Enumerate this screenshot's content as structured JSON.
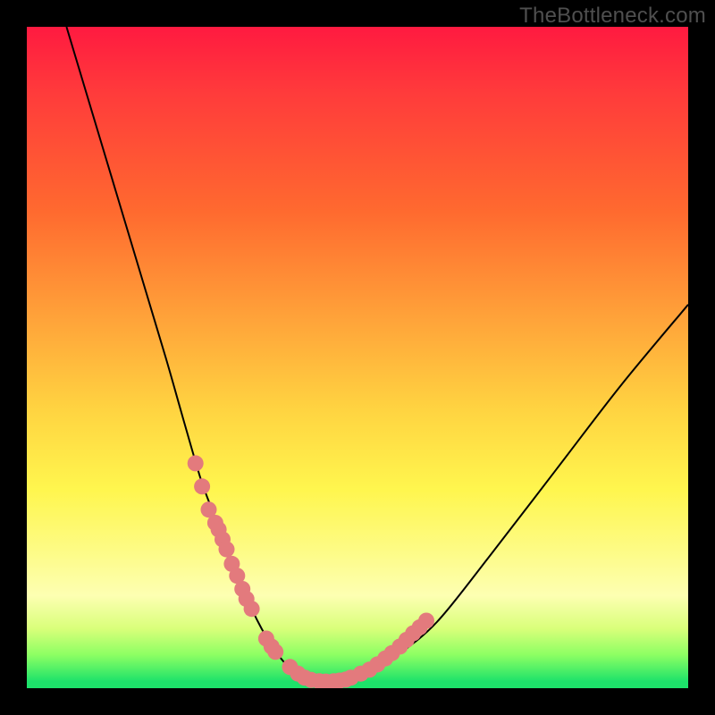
{
  "watermark": "TheBottleneck.com",
  "colors": {
    "background": "#000000",
    "gradient_top": "#ff1a40",
    "gradient_bottom": "#1de26a",
    "curve": "#000000",
    "dots": "#e37a7d"
  },
  "chart_data": {
    "type": "line",
    "title": "",
    "xlabel": "",
    "ylabel": "",
    "xlim": [
      0,
      100
    ],
    "ylim": [
      0,
      100
    ],
    "grid": false,
    "legend": false,
    "series": [
      {
        "name": "bottleneck-curve",
        "x": [
          6,
          9,
          12,
          15,
          18,
          21,
          23,
          25,
          26.5,
          28,
          29.5,
          31,
          32.5,
          34,
          35.5,
          37,
          38.5,
          40,
          41.5,
          43,
          45,
          48,
          52,
          56,
          62,
          70,
          80,
          90,
          100
        ],
        "y": [
          100,
          90,
          80,
          70,
          60,
          50,
          43,
          36,
          31,
          27,
          23,
          19,
          15.5,
          12,
          9,
          6.5,
          4.4,
          2.8,
          1.7,
          1.2,
          1.0,
          1.2,
          2.5,
          5,
          10,
          20,
          33,
          46,
          58
        ]
      }
    ],
    "scatter_overlay": {
      "name": "highlight-dots",
      "color": "#e37a7d",
      "points": [
        {
          "x": 25.5,
          "y": 34
        },
        {
          "x": 26.5,
          "y": 30.5
        },
        {
          "x": 27.5,
          "y": 27
        },
        {
          "x": 28.5,
          "y": 25
        },
        {
          "x": 29.0,
          "y": 24
        },
        {
          "x": 29.6,
          "y": 22.5
        },
        {
          "x": 30.2,
          "y": 21
        },
        {
          "x": 31.0,
          "y": 18.8
        },
        {
          "x": 31.8,
          "y": 17
        },
        {
          "x": 32.6,
          "y": 15
        },
        {
          "x": 33.2,
          "y": 13.5
        },
        {
          "x": 34.0,
          "y": 12
        },
        {
          "x": 36.2,
          "y": 7.5
        },
        {
          "x": 37.0,
          "y": 6.3
        },
        {
          "x": 37.6,
          "y": 5.5
        },
        {
          "x": 39.8,
          "y": 3.2
        },
        {
          "x": 41.0,
          "y": 2.2
        },
        {
          "x": 42.0,
          "y": 1.6
        },
        {
          "x": 43.0,
          "y": 1.25
        },
        {
          "x": 44.2,
          "y": 1.05
        },
        {
          "x": 45.2,
          "y": 1.0
        },
        {
          "x": 46.4,
          "y": 1.05
        },
        {
          "x": 47.3,
          "y": 1.15
        },
        {
          "x": 48.2,
          "y": 1.3
        },
        {
          "x": 49.0,
          "y": 1.6
        },
        {
          "x": 50.5,
          "y": 2.2
        },
        {
          "x": 51.8,
          "y": 2.8
        },
        {
          "x": 53.0,
          "y": 3.6
        },
        {
          "x": 54.2,
          "y": 4.5
        },
        {
          "x": 55.2,
          "y": 5.3
        },
        {
          "x": 56.4,
          "y": 6.3
        },
        {
          "x": 57.4,
          "y": 7.3
        },
        {
          "x": 58.4,
          "y": 8.3
        },
        {
          "x": 59.4,
          "y": 9.2
        },
        {
          "x": 60.4,
          "y": 10.2
        }
      ]
    }
  }
}
